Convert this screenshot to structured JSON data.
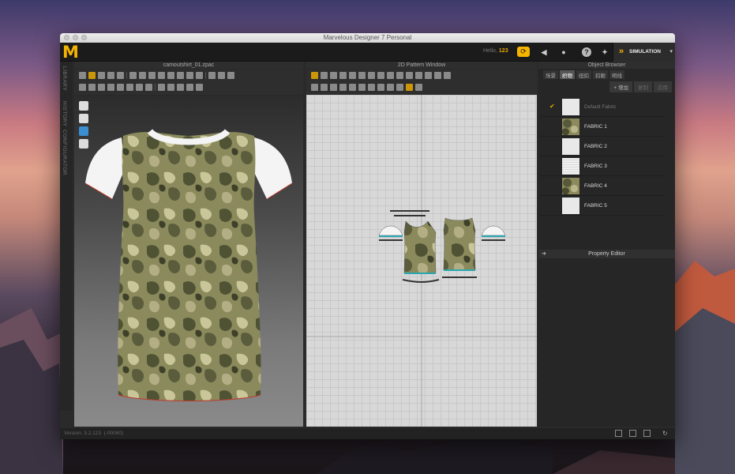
{
  "window": {
    "title": "Marvelous Designer 7 Personal"
  },
  "menubar": {
    "logo": "M",
    "hello_label": "Hello,",
    "user": "123",
    "simulation_label": "SIMULATION"
  },
  "sidetabs": [
    "LIBRARY",
    "HISTORY",
    "CONFIGURATOR"
  ],
  "panels": {
    "view3d_title": "camoutshirt_01.zpac",
    "view2d_title": "2D Pattern Window",
    "object_browser_title": "Object Browser",
    "property_editor_title": "Property Editor"
  },
  "object_browser": {
    "tabs": [
      "场景",
      "织物",
      "纽扣",
      "扣眼",
      "明线"
    ],
    "active_tab": "织物",
    "actions": {
      "add": "+ 增加",
      "copy": "复制",
      "apply": "应用"
    },
    "fabrics": [
      {
        "name": "Default Fabric",
        "swatch": "white",
        "checked": true
      },
      {
        "name": "FABRIC 1",
        "swatch": "camo",
        "checked": false
      },
      {
        "name": "FABRIC 2",
        "swatch": "white",
        "checked": false
      },
      {
        "name": "FABRIC 3",
        "swatch": "lines",
        "checked": false
      },
      {
        "name": "FABRIC 4",
        "swatch": "camo",
        "checked": false
      },
      {
        "name": "FABRIC 5",
        "swatch": "white",
        "checked": false
      }
    ]
  },
  "status": {
    "version": "Version: 3.2.123",
    "coords": "(-00060)"
  },
  "colors": {
    "accent": "#f5b400",
    "bg": "#2a2a2a",
    "grid": "#d8d8d8",
    "trim_teal": "#2aa6b0",
    "hem_red": "#c0392b"
  }
}
